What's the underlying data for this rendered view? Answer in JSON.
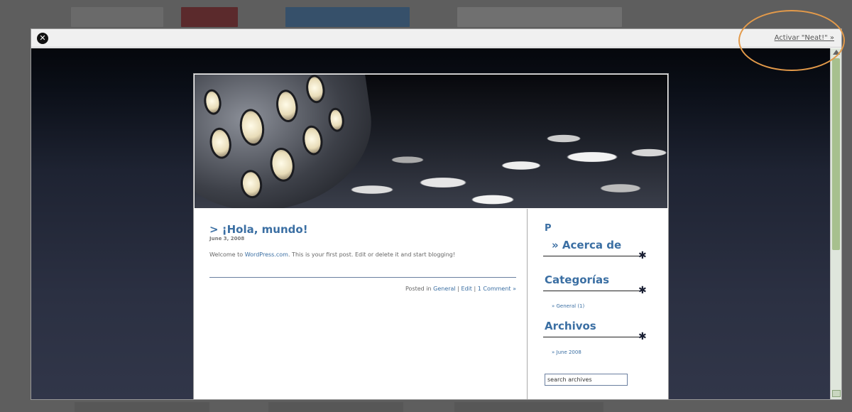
{
  "modal": {
    "close_glyph": "✕",
    "activate_label": "Activar \"Neat!\" »"
  },
  "post": {
    "title": "> ¡Hola, mundo!",
    "date": "June 3, 2008",
    "body_prefix": "Welcome to ",
    "body_link": "WordPress.com",
    "body_suffix": ". This is your first post. Edit or delete it and start blogging!",
    "meta_prefix": "Posted in ",
    "meta_category": "General",
    "meta_sep": " | ",
    "meta_edit": "Edit",
    "meta_sep2": " | ",
    "meta_comments": "1 Comment »"
  },
  "sidebar": {
    "p_label": "P",
    "pages_heading": "» Acerca de",
    "categories_heading": "Categorías",
    "categories_items": [
      "» General (1)"
    ],
    "archives_heading": "Archivos",
    "archives_items": [
      "» June 2008"
    ],
    "search_value": "search archives",
    "star_glyph": "✱"
  }
}
